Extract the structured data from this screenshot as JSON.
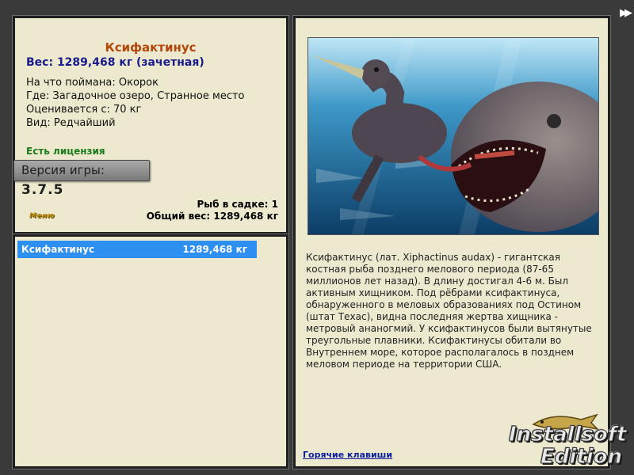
{
  "fish": {
    "name": "Ксифактинус",
    "weight_line": "Вес: 1289,468 кг (зачетная)",
    "caught_with": "На что поймана: Окорок",
    "location": "Где: Загадочное озеро, Странное место",
    "valuation": "Оценивается с: 70 кг",
    "rarity": "Вид: Редчайший"
  },
  "license": "Есть лицензия",
  "version": {
    "label": "Версия игры:",
    "number": "3.7.5"
  },
  "menu_label": "Меню",
  "stats": {
    "in_cage": "Рыб в садке: 1",
    "total_weight": "Общий вес: 1289,468 кг"
  },
  "catch_list": [
    {
      "name": "Ксифактинус",
      "weight": "1289,468 кг"
    }
  ],
  "description": "Ксифактинус (лат. Xiphactinus audax) - гигантская костная рыба позднего мелового периода (87-65 миллионов лет назад). В длину достигал 4-6 м. Был активным хищником. Под рёбрами ксифактинуса, обнаруженного в меловых образованиях под Остином (штат Техас), видна последняя жертва хищника - метровый ананогмий. У ксифактинусов были вытянутые треугольные плавники. Ксифактинусы обитали во Внутреннем море, которое располагалось в позднем меловом периоде на территории США.",
  "hotkeys_link": "Горячие клавиши",
  "logo": {
    "line1": "Installsoft",
    "line2": "Edition"
  },
  "nav": {
    "forward_icon": "fast-forward-icon"
  },
  "colors": {
    "panel_bg": "#ece9cf",
    "fish_title": "#b5470b",
    "weight": "#1a1a8a",
    "license": "#1d7a1d",
    "selection": "#2d8ff0",
    "link": "#0c1f9e"
  }
}
